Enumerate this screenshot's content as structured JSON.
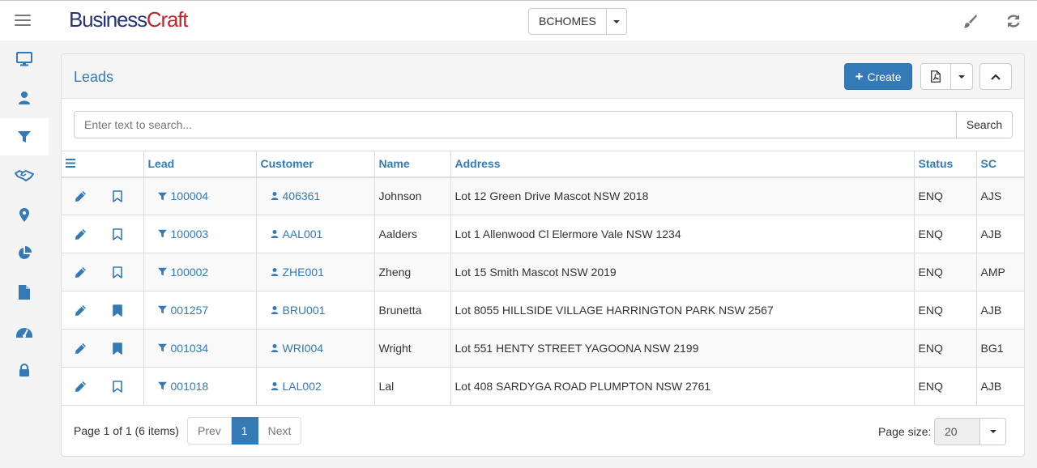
{
  "header": {
    "logo_part1": "Business",
    "logo_part2": "Craft",
    "company": "BCHOMES",
    "icons": [
      "hamburger-icon",
      "brush-icon",
      "refresh-icon"
    ]
  },
  "sidebar": {
    "items": [
      {
        "name": "desktop-icon"
      },
      {
        "name": "user-icon"
      },
      {
        "name": "filter-icon",
        "active": true
      },
      {
        "name": "handshake-icon"
      },
      {
        "name": "map-marker-icon"
      },
      {
        "name": "pie-chart-icon"
      },
      {
        "name": "document-icon"
      },
      {
        "name": "dashboard-icon"
      },
      {
        "name": "lock-icon"
      }
    ]
  },
  "panel": {
    "title": "Leads",
    "create_label": "Create"
  },
  "search": {
    "placeholder": "Enter text to search...",
    "button_label": "Search"
  },
  "table": {
    "columns": [
      "Lead",
      "Customer",
      "Name",
      "Address",
      "Status",
      "SC"
    ],
    "rows": [
      {
        "lead": "100004",
        "customer": "406361",
        "name": "Johnson",
        "address": "Lot 12 Green Drive Mascot NSW 2018",
        "status": "ENQ",
        "sc": "AJS",
        "bookmarked": false
      },
      {
        "lead": "100003",
        "customer": "AAL001",
        "name": "Aalders",
        "address": "Lot 1 Allenwood Cl Elermore Vale NSW 1234",
        "status": "ENQ",
        "sc": "AJB",
        "bookmarked": false
      },
      {
        "lead": "100002",
        "customer": "ZHE001",
        "name": "Zheng",
        "address": "Lot 15 Smith Mascot NSW 2019",
        "status": "ENQ",
        "sc": "AMP",
        "bookmarked": false
      },
      {
        "lead": "001257",
        "customer": "BRU001",
        "name": "Brunetta",
        "address": "Lot 8055 HILLSIDE VILLAGE HARRINGTON PARK NSW 2567",
        "status": "ENQ",
        "sc": "AJB",
        "bookmarked": true
      },
      {
        "lead": "001034",
        "customer": "WRI004",
        "name": "Wright",
        "address": "Lot 551 HENTY STREET YAGOONA NSW 2199",
        "status": "ENQ",
        "sc": "BG1",
        "bookmarked": true
      },
      {
        "lead": "001018",
        "customer": "LAL002",
        "name": "Lal",
        "address": "Lot 408 SARDYGA ROAD PLUMPTON NSW 2761",
        "status": "ENQ",
        "sc": "AJB",
        "bookmarked": false
      }
    ]
  },
  "footer": {
    "page_info": "Page 1 of 1 (6 items)",
    "prev_label": "Prev",
    "current_page": "1",
    "next_label": "Next",
    "page_size_label": "Page size:",
    "page_size": "20"
  },
  "colors": {
    "accent": "#337ab7",
    "logo_blue": "#27347a",
    "logo_red": "#c0262c"
  }
}
